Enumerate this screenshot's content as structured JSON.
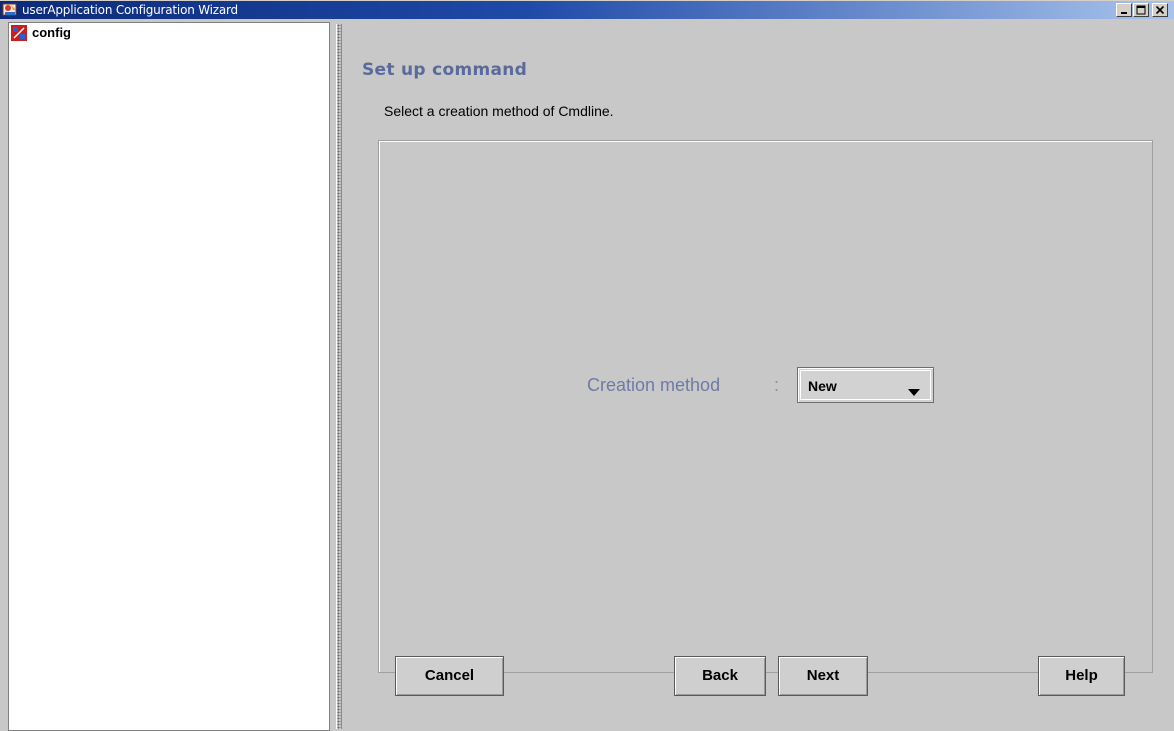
{
  "window": {
    "title": "userApplication Configuration Wizard",
    "icon": "app-wizard-icon"
  },
  "tree": {
    "root": {
      "label": "config",
      "icon": "config-node-icon"
    }
  },
  "main": {
    "heading": "Set up command",
    "instruction": "Select a creation method of Cmdline.",
    "creation_method": {
      "label": "Creation method",
      "separator": ":",
      "selected": "New"
    }
  },
  "buttons": {
    "cancel": "Cancel",
    "back": "Back",
    "next": "Next",
    "help": "Help"
  },
  "colors": {
    "titlebar_start": "#0b2a7a",
    "titlebar_end": "#a9c3ec",
    "heading": "#5a6a9a",
    "field_label": "#6f7aa6",
    "window_bg": "#c8c8c8"
  }
}
